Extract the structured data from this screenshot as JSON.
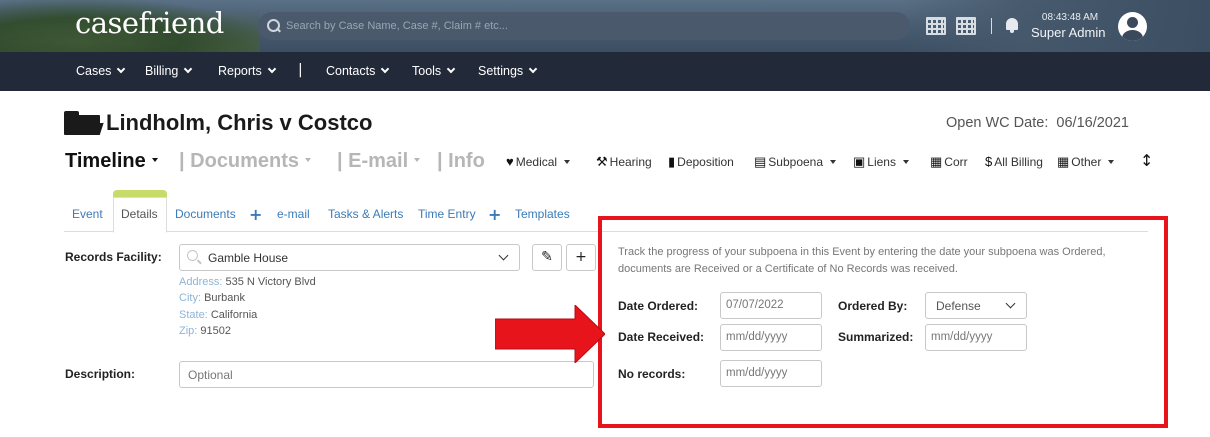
{
  "header": {
    "logo": "casefriend",
    "search_placeholder": "Search by Case Name, Case #, Claim # etc...",
    "time": "08:43:48 AM",
    "user": "Super Admin"
  },
  "nav": [
    "Cases",
    "Billing",
    "Reports",
    "|",
    "Contacts",
    "Tools",
    "Settings"
  ],
  "case": {
    "title": "Lindholm, Chris v Costco",
    "open_date_label": "Open WC Date:",
    "open_date": "06/16/2021"
  },
  "sections": {
    "timeline": "Timeline",
    "documents": "| Documents",
    "email": "| E-mail",
    "info": "| Info"
  },
  "tools": {
    "medical": "Medical",
    "hearing": "Hearing",
    "deposition": "Deposition",
    "subpoena": "Subpoena",
    "liens": "Liens",
    "corr": "Corr",
    "all_billing": "All Billing",
    "other": "Other"
  },
  "subtabs": {
    "event": "Event",
    "details": "Details",
    "documents": "Documents",
    "email": "e-mail",
    "tasks": "Tasks & Alerts",
    "time_entry": "Time Entry",
    "templates": "Templates"
  },
  "form": {
    "facility_label": "Records Facility:",
    "facility_value": "Gamble House",
    "address_k": "Address:",
    "address_v": "535 N Victory Blvd",
    "city_k": "City:",
    "city_v": "Burbank",
    "state_k": "State:",
    "state_v": "California",
    "zip_k": "Zip:",
    "zip_v": "91502",
    "description_label": "Description:",
    "description_placeholder": "Optional"
  },
  "subpoena": {
    "hint": "Track the progress of your subpoena in this Event by entering the date your subpoena was Ordered, documents are Received or a Certificate of No Records was received.",
    "date_ordered_label": "Date Ordered:",
    "date_ordered_value": "07/07/2022",
    "ordered_by_label": "Ordered By:",
    "ordered_by_value": "Defense",
    "date_received_label": "Date Received:",
    "date_received_placeholder": "mm/dd/yyyy",
    "summarized_label": "Summarized:",
    "summarized_placeholder": "mm/dd/yyyy",
    "no_records_label": "No records:",
    "no_records_placeholder": "mm/dd/yyyy"
  },
  "colors": {
    "highlight": "#e8141c",
    "nav_bg": "#222a3a",
    "link": "#3a7bb8",
    "tab_flag": "#c5dc6a"
  }
}
